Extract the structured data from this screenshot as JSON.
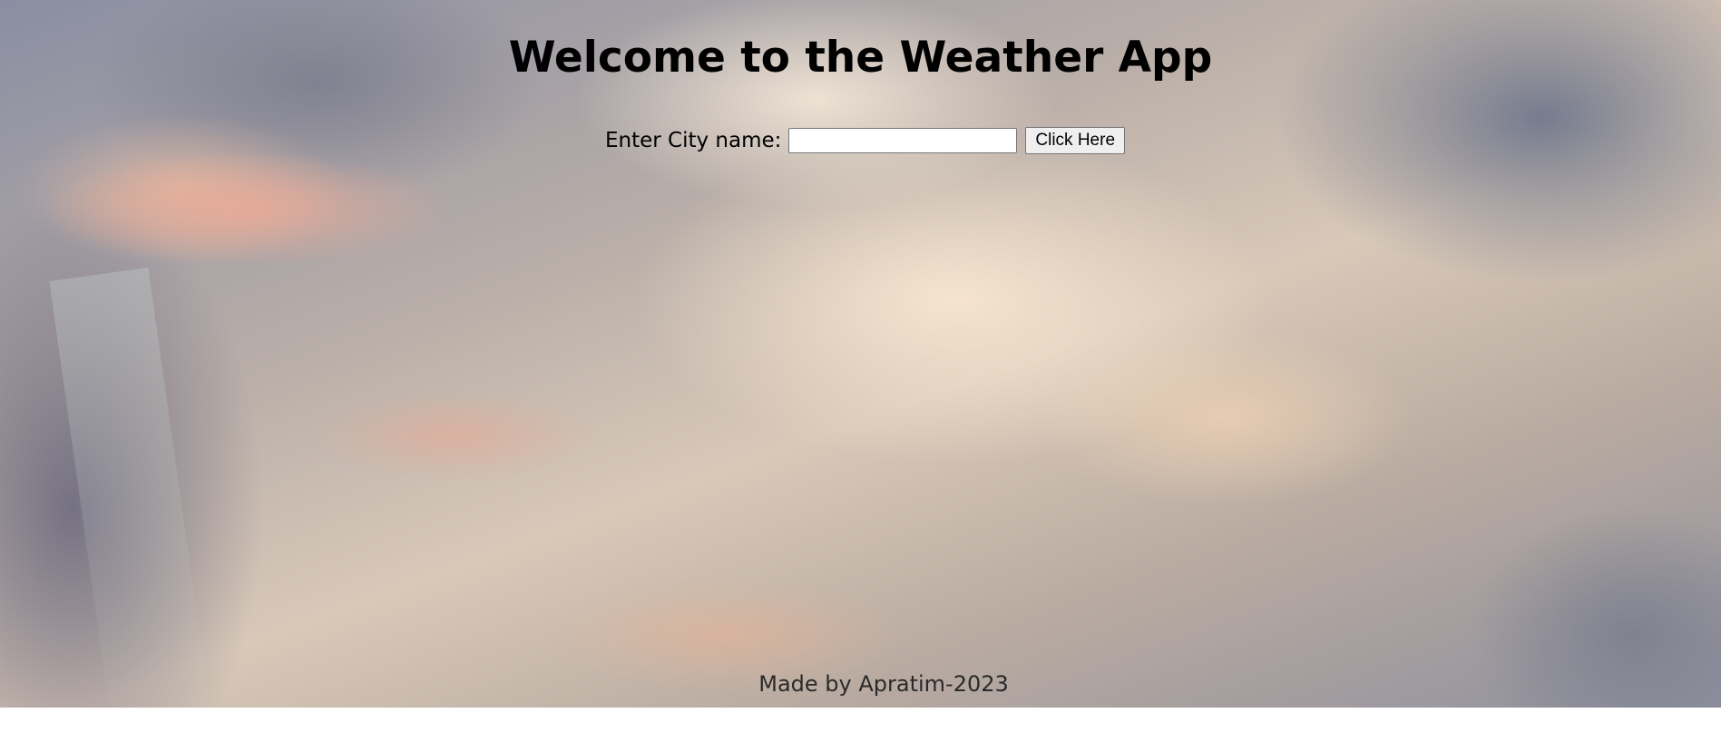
{
  "header": {
    "title": "Welcome to the Weather App"
  },
  "search": {
    "label": "Enter City name:",
    "input_value": "",
    "button_label": "Click Here"
  },
  "footer": {
    "text": "Made by Apratim-2023"
  }
}
